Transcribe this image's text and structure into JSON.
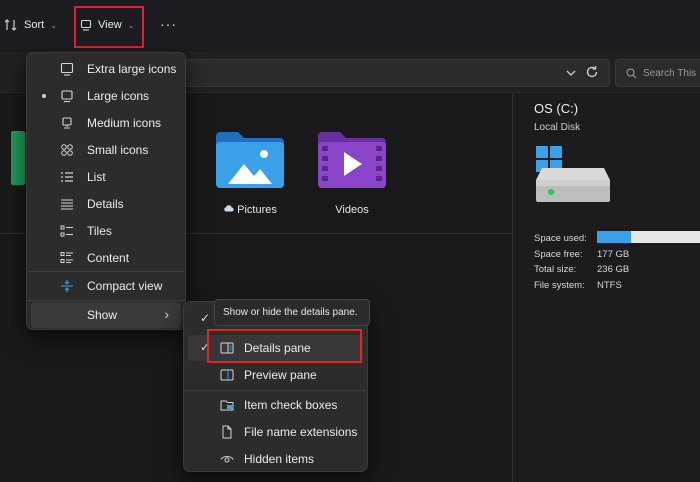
{
  "toolbar": {
    "sort_label": "Sort",
    "view_label": "View",
    "more_label": "···",
    "chevron": "⌄"
  },
  "address": {
    "search_placeholder": "Search This"
  },
  "folders": [
    {
      "name": "Pictures",
      "icon": "pictures-folder-icon",
      "color": "#2d8fe0"
    },
    {
      "name": "Videos",
      "icon": "videos-folder-icon",
      "color": "#8a44c8"
    }
  ],
  "view_menu": {
    "items": [
      {
        "label": "Extra large icons",
        "icon": "monitor-icon",
        "selected": false
      },
      {
        "label": "Large icons",
        "icon": "monitor-icon",
        "selected": true
      },
      {
        "label": "Medium icons",
        "icon": "monitor-stand-icon",
        "selected": false
      },
      {
        "label": "Small icons",
        "icon": "small-icons-grid-icon",
        "selected": false
      },
      {
        "label": "List",
        "icon": "list-icon",
        "selected": false
      },
      {
        "label": "Details",
        "icon": "details-lines-icon",
        "selected": false
      },
      {
        "label": "Tiles",
        "icon": "tiles-icon",
        "selected": false
      },
      {
        "label": "Content",
        "icon": "content-icon",
        "selected": false
      }
    ],
    "compact_label": "Compact view",
    "show_label": "Show",
    "show_arrow": "›"
  },
  "tooltip": "Show or hide the details pane.",
  "show_menu": {
    "items": [
      {
        "label": "Details pane",
        "icon": "details-pane-icon",
        "checked": true
      },
      {
        "label": "Preview pane",
        "icon": "preview-pane-icon",
        "checked": false
      },
      {
        "label": "Item check boxes",
        "icon": "check-boxes-icon",
        "checked": false
      },
      {
        "label": "File name extensions",
        "icon": "file-icon",
        "checked": false
      },
      {
        "label": "Hidden items",
        "icon": "eye-icon",
        "checked": false
      }
    ],
    "check_glyph": "✓"
  },
  "details_pane": {
    "title": "OS (C:)",
    "subtitle": "Local Disk",
    "space_used_label": "Space used:",
    "space_used_fraction": 0.33,
    "space_free_label": "Space free:",
    "space_free_value": "177 GB",
    "total_size_label": "Total size:",
    "total_size_value": "236 GB",
    "file_system_label": "File system:",
    "file_system_value": "NTFS"
  },
  "colors": {
    "accent_blue": "#3aa0e8",
    "highlight_red": "#e0242a"
  }
}
